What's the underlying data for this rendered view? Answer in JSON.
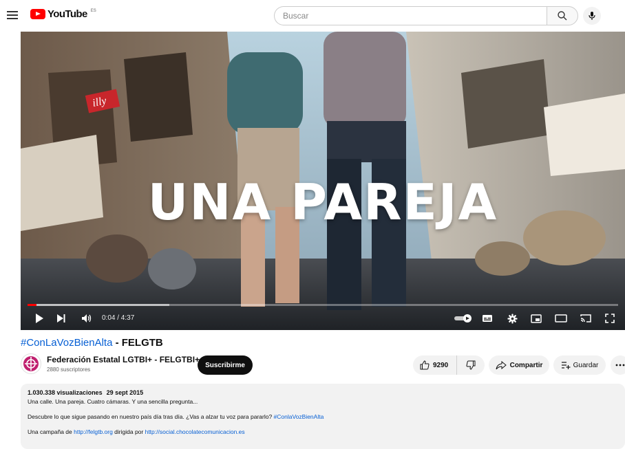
{
  "header": {
    "logo_text": "YouTube",
    "logo_country": "ES",
    "search_placeholder": "Buscar"
  },
  "video": {
    "overlay_text": "UNA PAREJA",
    "storefront_sign": "illy",
    "time_display": "0:04 / 4:37",
    "progress_fraction": 0.015,
    "buffered_fraction": 0.24
  },
  "title": {
    "hashtag": "#ConLaVozBienAlta",
    "rest": " - FELGTB"
  },
  "channel": {
    "name": "Federación Estatal LGTBI+ - FELGTBI+",
    "subscribers": "2880 suscriptores",
    "subscribe_label": "Suscribirme"
  },
  "actions": {
    "likes": "9290",
    "share_label": "Compartir",
    "save_label": "Guardar"
  },
  "description": {
    "views": "1.030.338 visualizaciones",
    "date": "29 sept 2015",
    "line1": "Una calle. Una pareja. Cuatro cámaras. Y una sencilla pregunta...",
    "line2_text": "Descubre lo que sigue pasando en nuestro país día tras día. ¿Vas a alzar tu voz para pararlo? ",
    "line2_hashtag": "#ConlaVozBienAlta",
    "line3_prefix": "Una campaña de ",
    "line3_link1": "http://felgtb.org",
    "line3_middle": " dirigida por ",
    "line3_link2": "http://social.chocolatecomunicacion.es"
  },
  "colors": {
    "brand_red": "#ff0000",
    "link_blue": "#065fd4",
    "pill_gray": "#f2f2f2"
  }
}
